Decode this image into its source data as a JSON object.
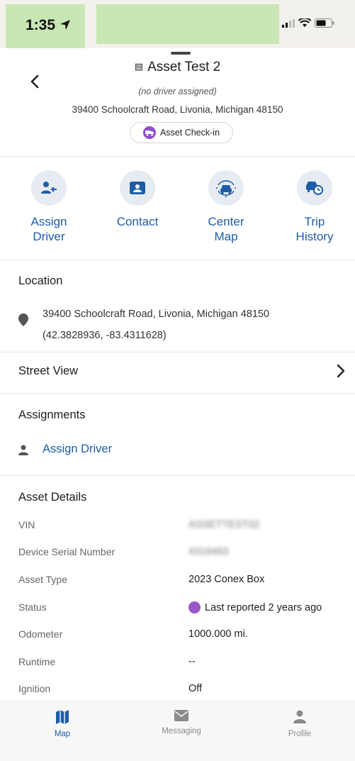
{
  "status_bar": {
    "time": "1:35"
  },
  "header": {
    "title": "Asset Test 2",
    "driver_note": "(no driver assigned)",
    "address": "39400 Schoolcraft Road, Livonia, Michigan 48150",
    "checkin_label": "Asset Check-in"
  },
  "actions": [
    {
      "label": "Assign\nDriver",
      "icon": "assign-driver-icon"
    },
    {
      "label": "Contact",
      "icon": "contact-card-icon"
    },
    {
      "label": "Center\nMap",
      "icon": "center-map-icon"
    },
    {
      "label": "Trip\nHistory",
      "icon": "trip-history-icon"
    }
  ],
  "location": {
    "title": "Location",
    "address": "39400 Schoolcraft Road, Livonia, Michigan 48150",
    "coordinates": "(42.3828936, -83.4311628)"
  },
  "street_view": {
    "label": "Street View"
  },
  "assignments": {
    "title": "Assignments",
    "assign_label": "Assign Driver"
  },
  "asset_details": {
    "title": "Asset Details",
    "rows": [
      {
        "label": "VIN",
        "value": "ASSETTEST02"
      },
      {
        "label": "Device Serial Number",
        "value": "4316463"
      },
      {
        "label": "Asset Type",
        "value": "2023 Conex Box"
      },
      {
        "label": "Status",
        "value": "Last reported 2 years ago"
      },
      {
        "label": "Odometer",
        "value": "1000.000 mi."
      },
      {
        "label": "Runtime",
        "value": "--"
      },
      {
        "label": "Ignition",
        "value": "Off"
      }
    ]
  },
  "tabs": [
    {
      "label": "Map",
      "icon": "map-icon",
      "active": true
    },
    {
      "label": "Messaging",
      "icon": "envelope-icon",
      "active": false
    },
    {
      "label": "Profile",
      "icon": "person-icon",
      "active": false
    }
  ],
  "colors": {
    "accent": "#1d5da8",
    "status_purple": "#9b55c9",
    "icon_circle": "#e7ecf3"
  }
}
